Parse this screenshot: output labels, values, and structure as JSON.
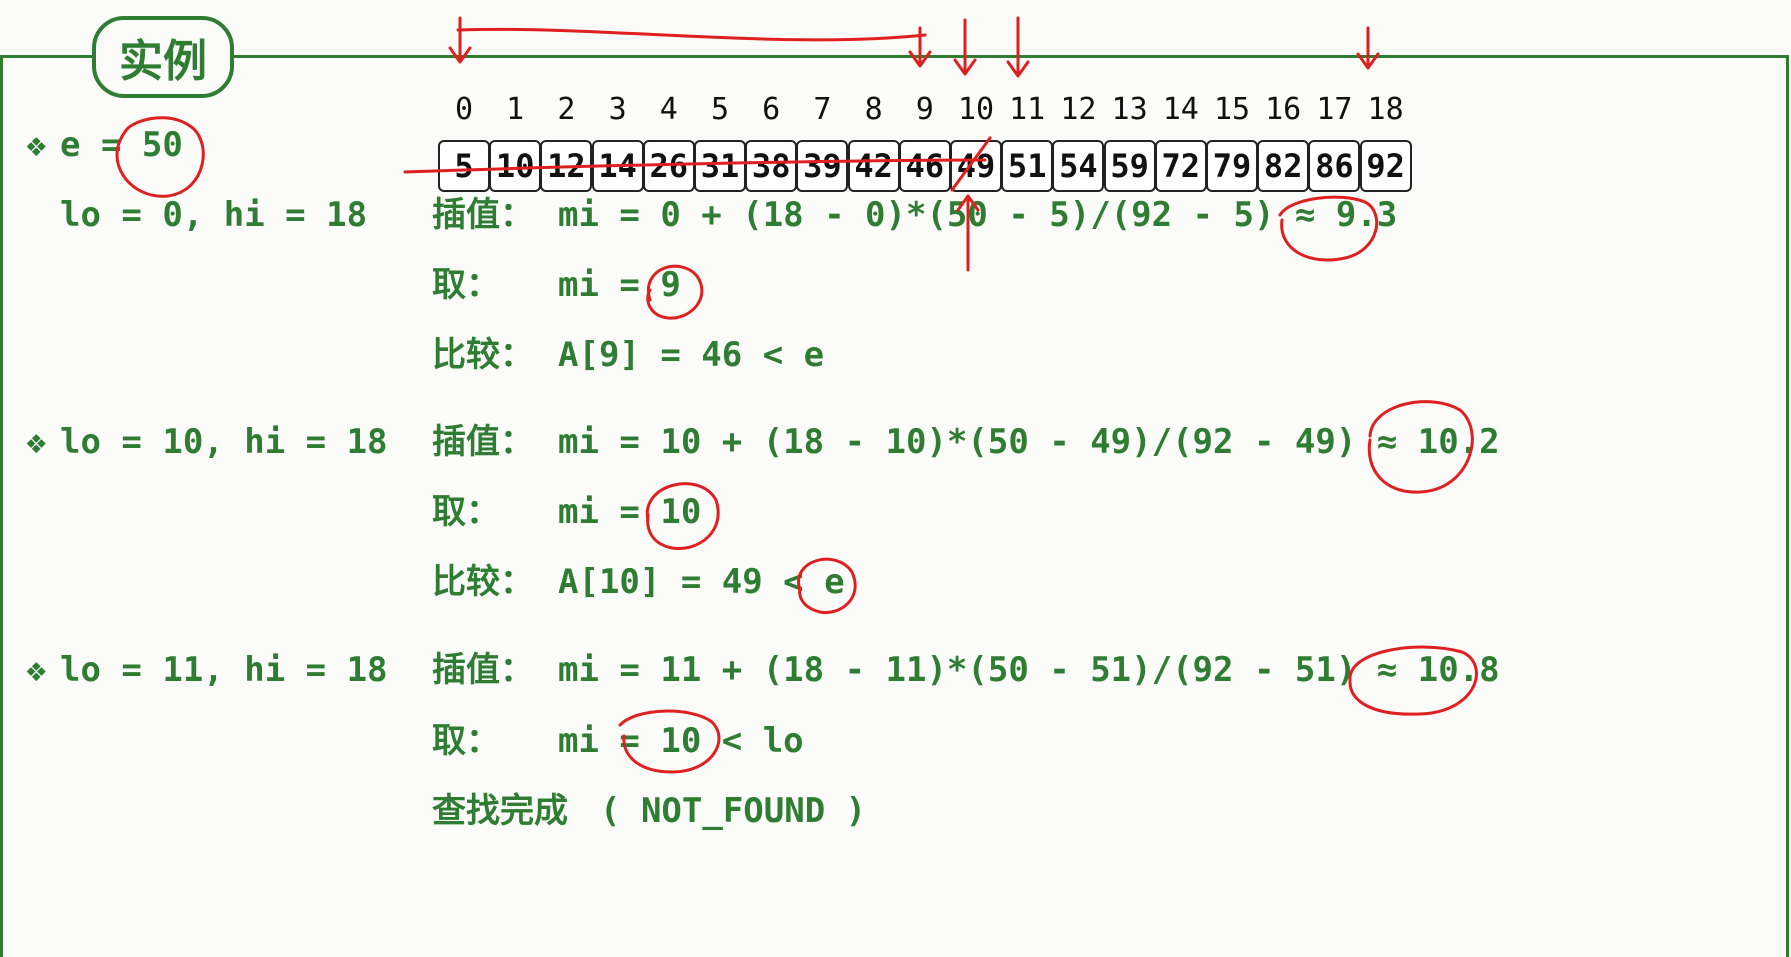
{
  "title": "实例",
  "array": {
    "indices": [
      "0",
      "1",
      "2",
      "3",
      "4",
      "5",
      "6",
      "7",
      "8",
      "9",
      "10",
      "11",
      "12",
      "13",
      "14",
      "15",
      "16",
      "17",
      "18"
    ],
    "values": [
      "5",
      "10",
      "12",
      "14",
      "26",
      "31",
      "38",
      "39",
      "42",
      "46",
      "49",
      "51",
      "54",
      "59",
      "72",
      "79",
      "82",
      "86",
      "92"
    ]
  },
  "bullet_icon": "diamond-cluster-icon",
  "colors": {
    "accent_green": "#2e7d32",
    "annotation_red": "#e02020"
  },
  "steps": [
    {
      "bullet": "❖",
      "left_text": "e = 50"
    },
    {
      "left_text": "lo = 0, hi = 18",
      "interp_label": "插值：",
      "interp_expr": "mi = 0 + (18 - 0)*(50 - 5)/(92 - 5) ≈ 9.3",
      "take_label": "取：",
      "take_expr": "mi = 9",
      "cmp_label": "比较：",
      "cmp_expr": "A[9] = 46 < e"
    },
    {
      "bullet": "❖",
      "left_text": "lo = 10, hi = 18",
      "interp_label": "插值：",
      "interp_expr": "mi = 10 + (18 - 10)*(50 - 49)/(92 - 49) ≈ 10.2",
      "take_label": "取：",
      "take_expr": "mi = 10",
      "cmp_label": "比较：",
      "cmp_expr": "A[10] = 49 < e"
    },
    {
      "bullet": "❖",
      "left_text": "lo = 11, hi = 18",
      "interp_label": "插值：",
      "interp_expr": "mi = 11 + (18 - 11)*(50 - 51)/(92 - 51) ≈ 10.8",
      "take_label": "取：",
      "take_expr": "mi = 10 < lo",
      "result_label": "查找完成",
      "result_value": "( NOT_FOUND )"
    }
  ]
}
